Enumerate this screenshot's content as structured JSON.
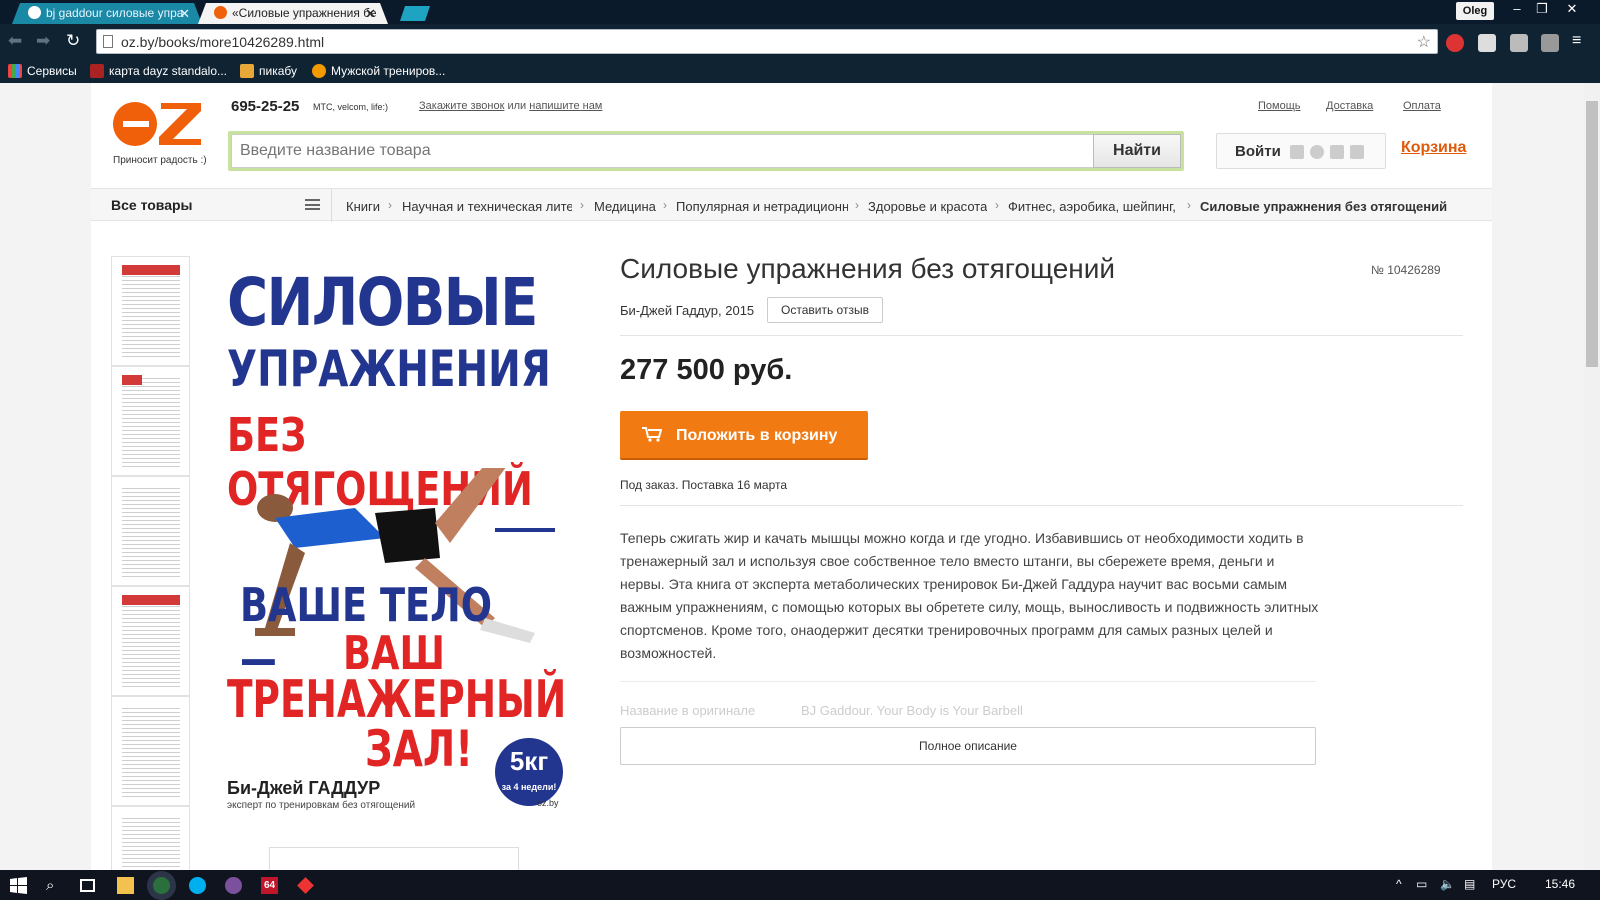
{
  "browser": {
    "tabs": [
      {
        "label": "bj gaddour силовые упра"
      },
      {
        "label": "«Силовые упражнения бе"
      }
    ],
    "user": "Oleg",
    "url": "oz.by/books/more10426289.html",
    "bookmarks": [
      {
        "label": "Сервисы"
      },
      {
        "label": "карта dayz standalo..."
      },
      {
        "label": "пикабу"
      },
      {
        "label": "Мужской трениров..."
      }
    ]
  },
  "header": {
    "slogan": "Приносит радость :)",
    "phone": "695-25-25",
    "operators": "МТС, velcom, life:)",
    "callback": "Закажите звонок",
    "or": "или",
    "write": "напишите нам",
    "links": [
      "Помощь",
      "Доставка",
      "Оплата"
    ],
    "search_placeholder": "Введите название товара",
    "search_button": "Найти",
    "login": "Войти",
    "cart": "Корзина"
  },
  "catbar": {
    "all": "Все товары",
    "breadcrumbs": [
      "Книги",
      "Научная и техническая лите",
      "Медицина",
      "Популярная и нетрадиционн",
      "Здоровье и красота",
      "Фитнес, аэробика, шейпинг,",
      "Силовые упражнения без отягощений"
    ]
  },
  "cover": {
    "line1": "СИЛОВЫЕ",
    "line2": "УПРАЖНЕНИЯ",
    "line3": "БЕЗ ОТЯГОЩЕНИЙ",
    "line4": "ВАШЕ ТЕЛО —",
    "line5": "ВАШ",
    "line6": "ТРЕНАЖЕРНЫЙ",
    "line7": "ЗАЛ!",
    "author": "Би-Джей ГАДДУР",
    "subtitle": "эксперт по тренировкам без отягощений",
    "badge_num": "5кг",
    "badge_text": "за 4 недели!",
    "watermark": "oz.by"
  },
  "product": {
    "title": "Силовые упражнения без отягощений",
    "number": "№ 10426289",
    "author_year": "Би-Джей Гаддур, 2015",
    "review_button": "Оставить отзыв",
    "price": "277 500 руб.",
    "buy_button": "Положить в корзину",
    "availability": "Под заказ. Поставка 16 марта",
    "description": "Теперь сжигать жир и качать мышцы можно когда и где угодно. Избавившись от необходимости ходить в тренажерный зал и используя свое собственное тело вместо штанги, вы сбережете время, деньги и нервы. Эта книга от эксперта метаболических тренировок Би-Джей Гаддура научит вас восьми самым важным упражнениям, с помощью которых вы обретете силу, мощь, выносливость и подвижность элитных спортсменов. Кроме того, онаодержит десятки тренировочных программ для самых разных целей и возможностей.",
    "orig_label": "Название в оригинале",
    "orig_value": "BJ Gaddour. Your Body is Your Barbell",
    "full_desc_button": "Полное описание"
  },
  "taskbar": {
    "lang": "РУС",
    "time": "15:46",
    "badge": "64"
  },
  "colors": {
    "accent": "#f17b12",
    "brand_orange": "#f0600a",
    "cart_link": "#e05a0c"
  }
}
